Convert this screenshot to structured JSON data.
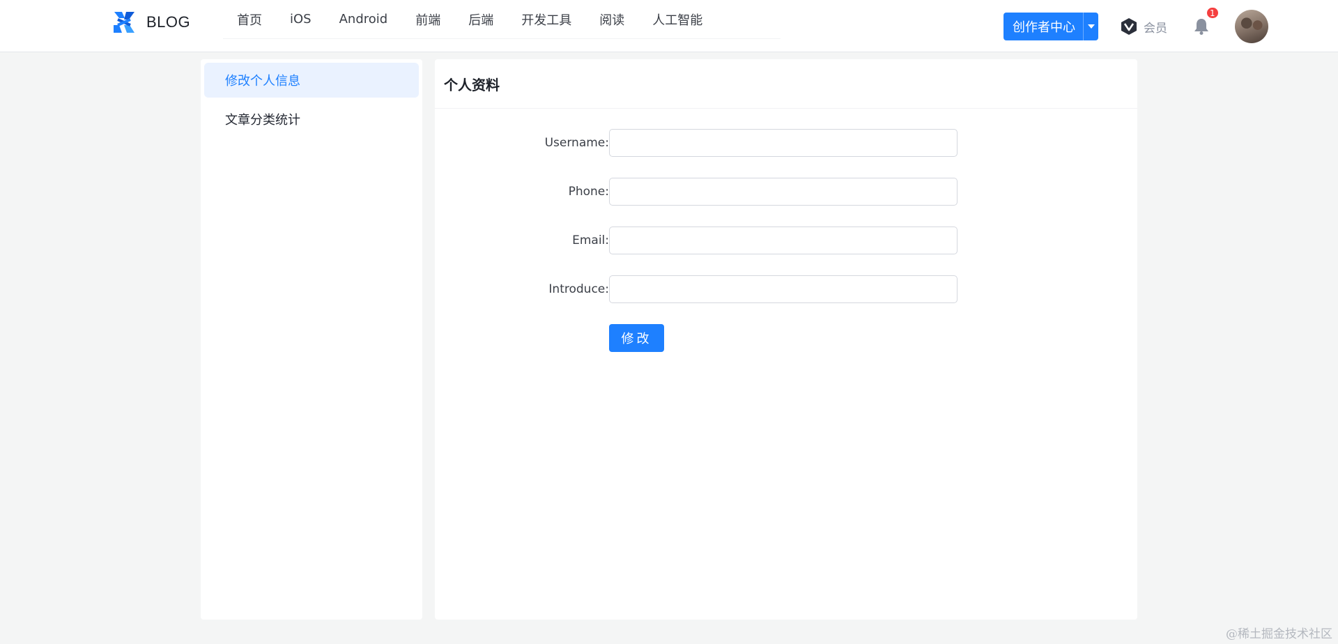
{
  "header": {
    "brand": "BLOG",
    "nav": [
      "首页",
      "iOS",
      "Android",
      "前端",
      "后端",
      "开发工具",
      "阅读",
      "人工智能"
    ],
    "creator_label": "创作者中心",
    "vip_label": "会员",
    "notification_count": "1",
    "accent_color": "#1e80ff"
  },
  "sidebar": {
    "items": [
      {
        "label": "修改个人信息",
        "active": true
      },
      {
        "label": "文章分类统计",
        "active": false
      }
    ]
  },
  "panel": {
    "title": "个人资料",
    "fields": [
      {
        "label": "Username",
        "separator": ":",
        "value": ""
      },
      {
        "label": "Phone",
        "separator": ":",
        "value": ""
      },
      {
        "label": "Email",
        "separator": ":",
        "value": ""
      },
      {
        "label": "Introduce",
        "separator": ":",
        "value": ""
      }
    ],
    "submit_label": "修改"
  },
  "watermark": "@稀土掘金技术社区"
}
